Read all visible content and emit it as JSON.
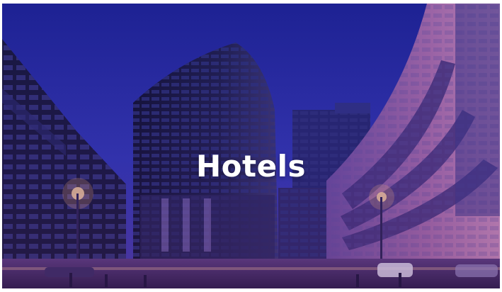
{
  "card": {
    "title": "Hotels",
    "image_description_icon": "city-buildings-photo"
  },
  "colors": {
    "sky": "#2a2fa8",
    "sky_dark": "#161a6e",
    "building_dark": "#141433",
    "building_mid": "#3b2f7a",
    "facade_pink": "#b06a9a",
    "light": "#ffd9a8",
    "title_text": "#ffffff"
  }
}
